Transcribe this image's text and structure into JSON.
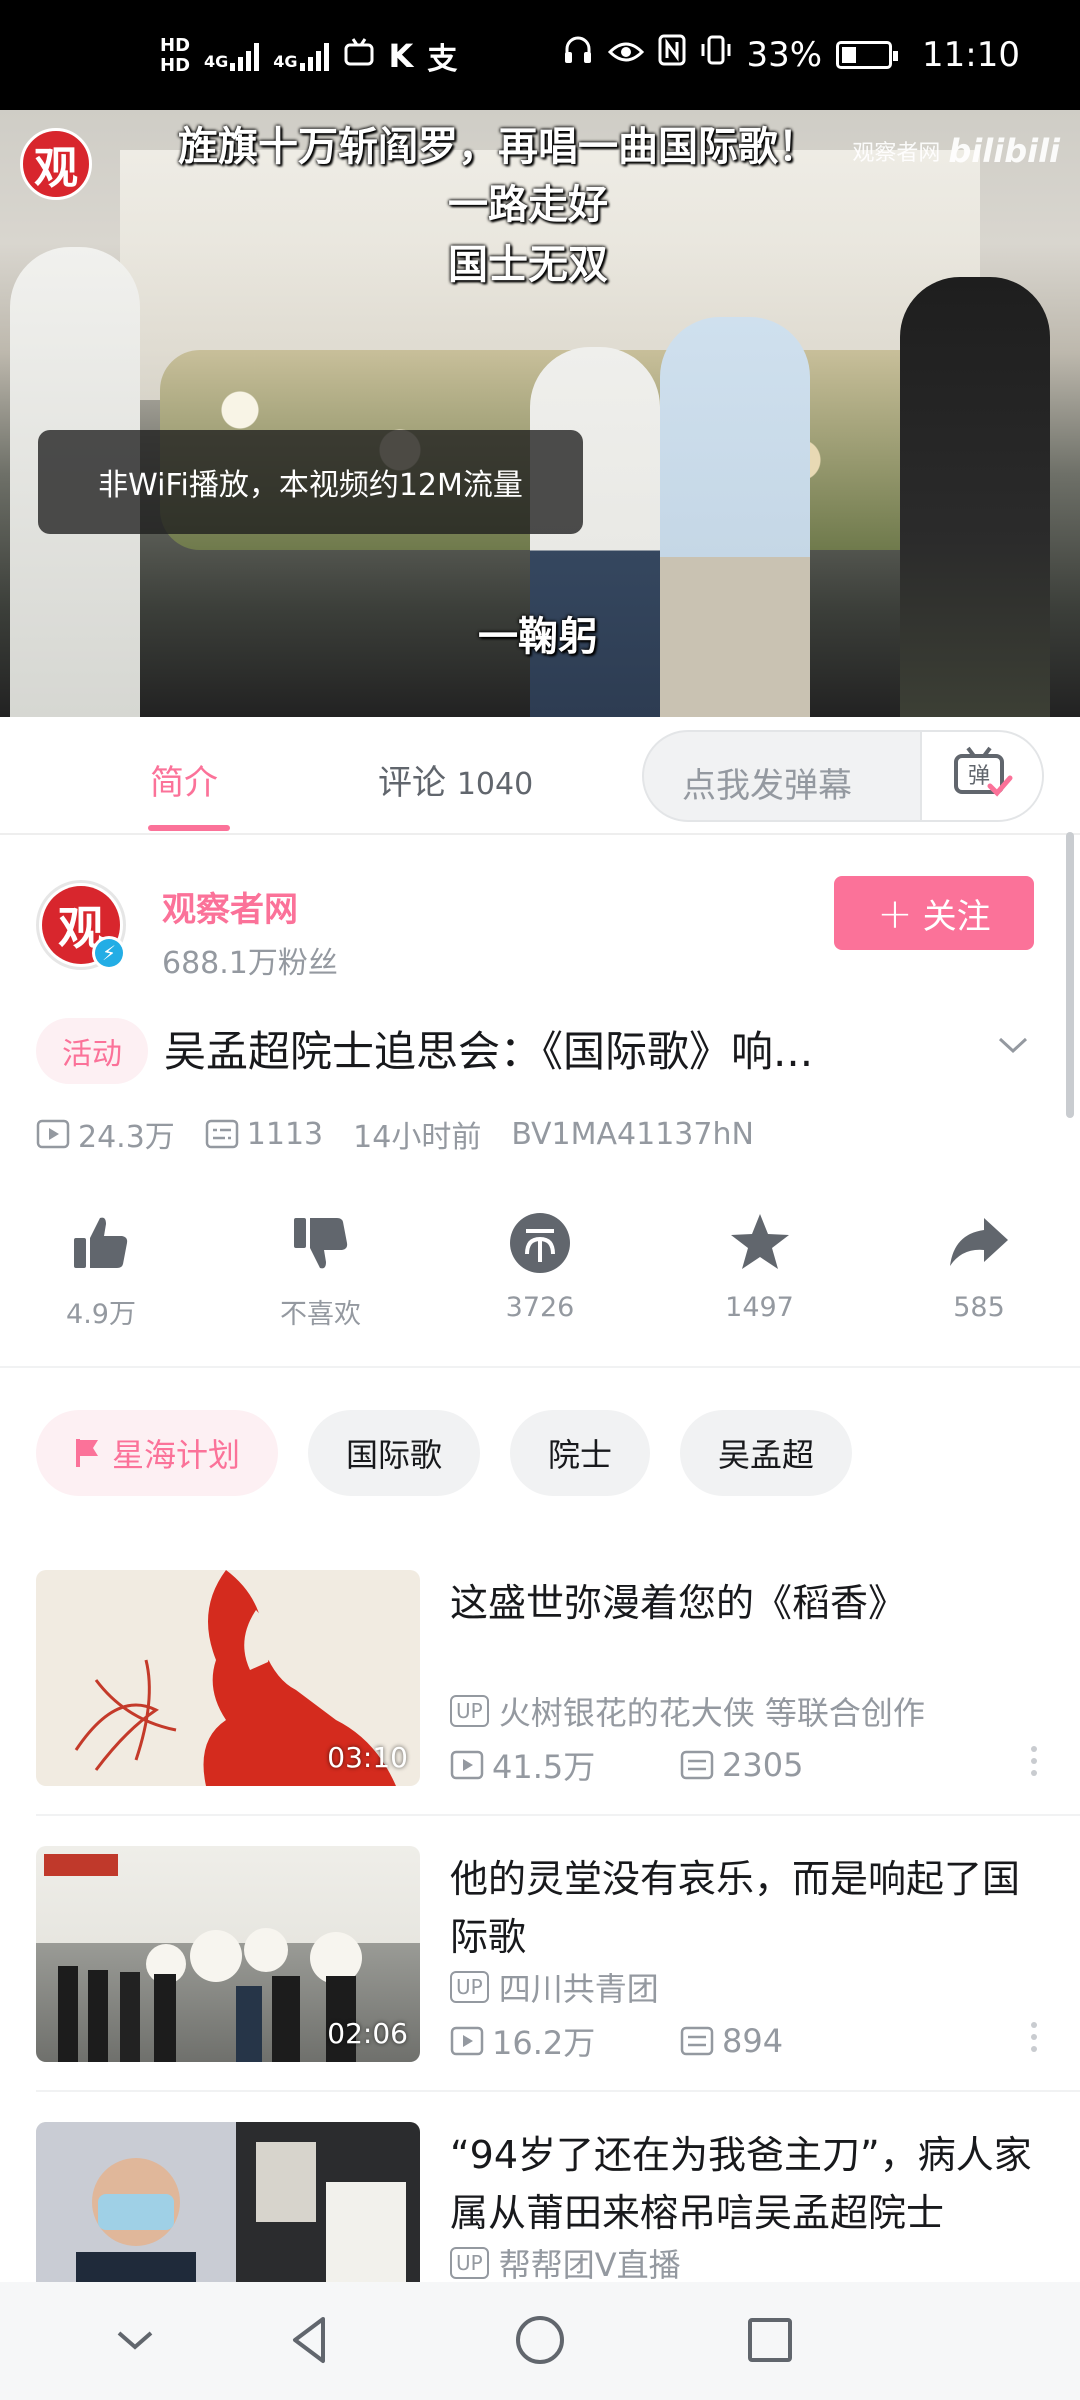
{
  "status_bar": {
    "hd1": "HD",
    "hd2": "HD",
    "net1": "4G",
    "net2": "4G",
    "app_icons": [
      "bilibili-tv-icon",
      "k-icon",
      "alipay-icon"
    ],
    "battery_pct": "33%",
    "time": "11:10"
  },
  "video": {
    "channel_logo": "观",
    "watermark_name": "观察者网",
    "watermark_brand": "bilibili",
    "danmaku": [
      "旌旗十万斩阎罗，再唱一曲国际歌！",
      "一路走好",
      "国士无双",
      "一鞠躬"
    ],
    "toast": "非WiFi播放，本视频约12M流量"
  },
  "tabs": {
    "intro": "简介",
    "comments_label": "评论",
    "comments_count": "1040",
    "danmaku_placeholder": "点我发弹幕",
    "danmaku_btn": "弹"
  },
  "uploader": {
    "avatar_text": "观",
    "name": "观察者网",
    "fans": "688.1万粉丝",
    "follow_label": "关注"
  },
  "video_info": {
    "badge": "活动",
    "title": "吴孟超院士追思会：《国际歌》响...",
    "views": "24.3万",
    "danmaku_count": "1113",
    "time_ago": "14小时前",
    "bvid": "BV1MA41137hN"
  },
  "actions": [
    {
      "name": "like",
      "label": "4.9万"
    },
    {
      "name": "dislike",
      "label": "不喜欢"
    },
    {
      "name": "coin",
      "label": "3726"
    },
    {
      "name": "favorite",
      "label": "1497"
    },
    {
      "name": "share",
      "label": "585"
    }
  ],
  "tags": [
    "星海计划",
    "国际歌",
    "院士",
    "吴孟超"
  ],
  "related": [
    {
      "title": "这盛世弥漫着您的《稻香》",
      "up": "火树银花的花大侠 等联合创作",
      "views": "41.5万",
      "danmaku": "2305",
      "duration": "03:10"
    },
    {
      "title": "他的灵堂没有哀乐，而是响起了国际歌",
      "up": "四川共青团",
      "views": "16.2万",
      "danmaku": "894",
      "duration": "02:06"
    },
    {
      "title": "“94岁了还在为我爸主刀”，病人家属从莆田来榕吊唁吴孟超院士",
      "up": "帮帮团V直播",
      "views": "",
      "danmaku": "",
      "duration": ""
    }
  ],
  "up_tag": "UP",
  "colors": {
    "accent": "#fb7299",
    "text": "#18191c",
    "secondary": "#9499a0"
  }
}
